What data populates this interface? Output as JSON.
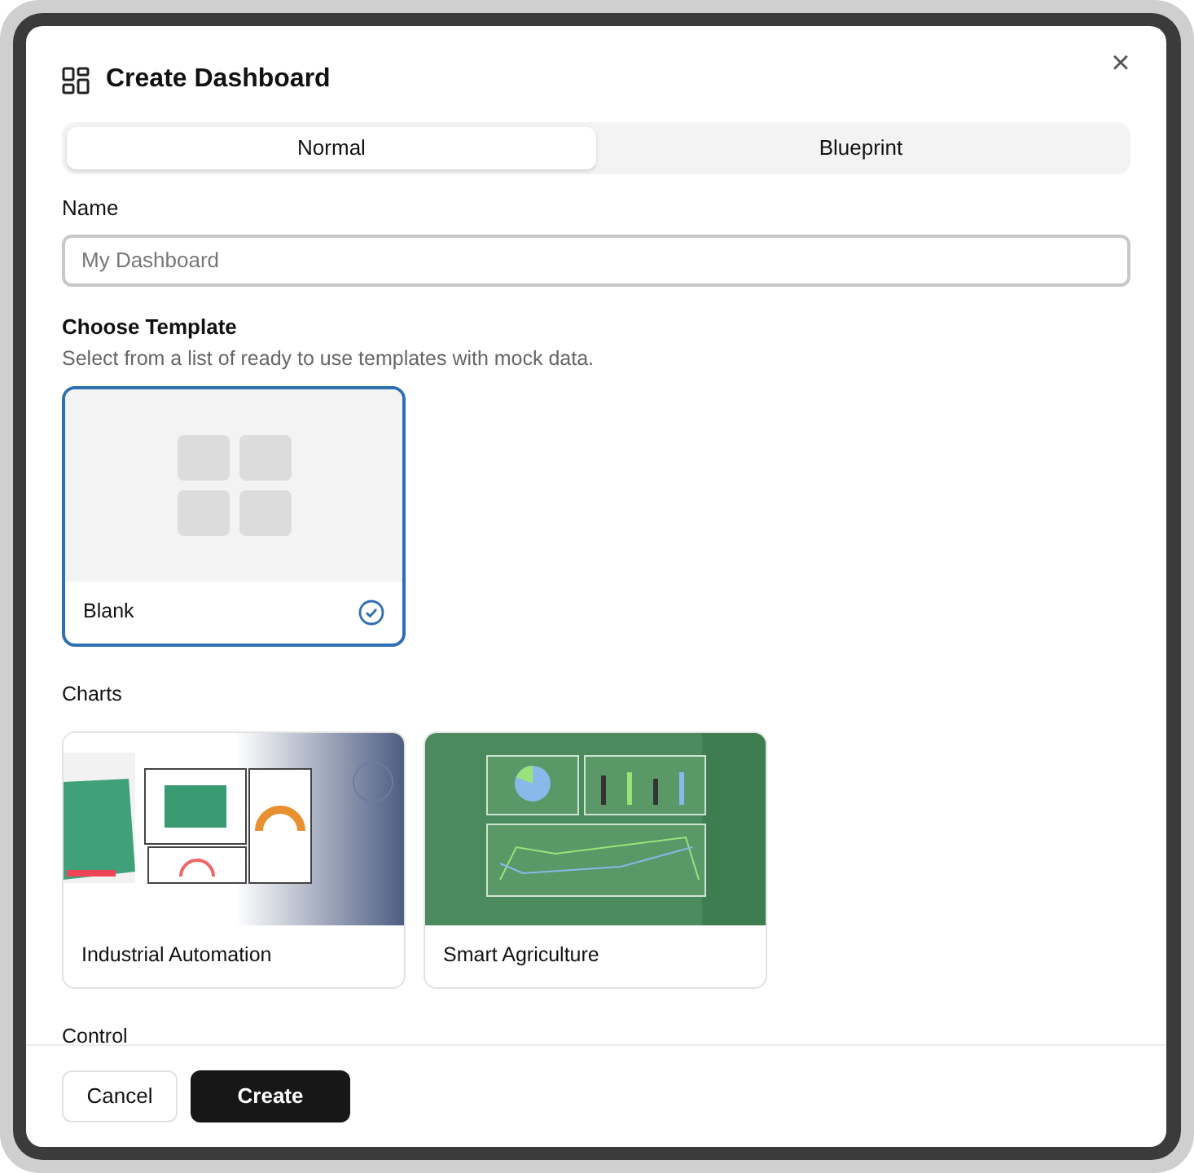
{
  "dialog": {
    "title": "Create Dashboard",
    "close": "×"
  },
  "tabs": [
    {
      "label": "Normal",
      "selected": true
    },
    {
      "label": "Blueprint",
      "selected": false
    }
  ],
  "name_field": {
    "label": "Name",
    "placeholder": "My Dashboard"
  },
  "template_header": {
    "title": "Choose Template",
    "description": "Select from a list of ready to use templates with mock data."
  },
  "sections": [
    {
      "templates": [
        {
          "name": "Blank",
          "kind": "blank",
          "selected": true
        }
      ]
    },
    {
      "title": "Charts",
      "templates": [
        {
          "name": "Industrial Automation",
          "kind": "industrial",
          "selected": false
        },
        {
          "name": "Smart Agriculture",
          "kind": "agriculture",
          "selected": false
        }
      ]
    },
    {
      "title": "Control"
    }
  ],
  "buttons": [
    {
      "label": "Cancel",
      "kind": "secondary"
    },
    {
      "label": "Create",
      "kind": "primary"
    }
  ]
}
